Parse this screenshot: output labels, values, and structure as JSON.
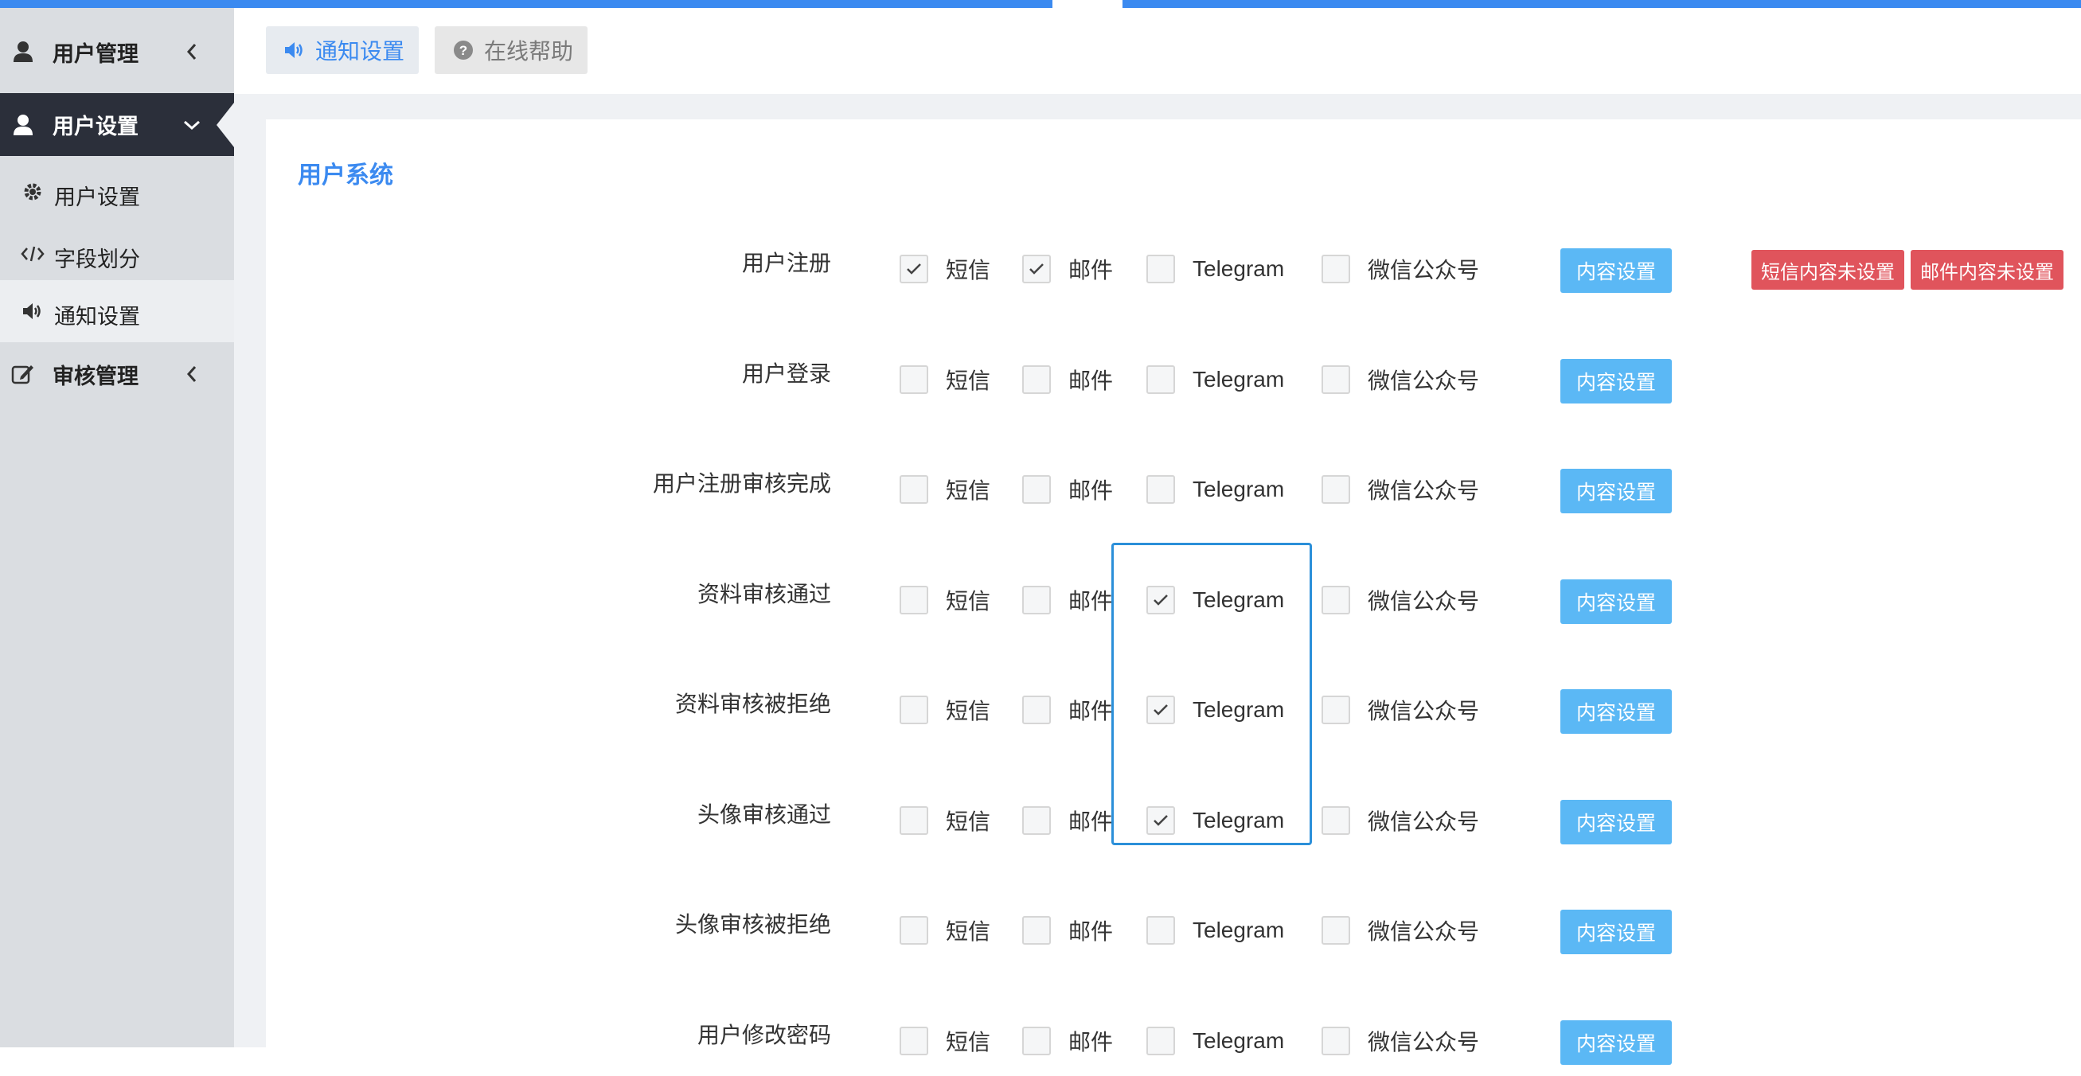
{
  "sidebar": {
    "items": [
      {
        "label": "用户管理"
      },
      {
        "label": "用户设置"
      },
      {
        "label": "审核管理"
      }
    ],
    "subitems": [
      {
        "label": "用户设置"
      },
      {
        "label": "字段划分"
      },
      {
        "label": "通知设置"
      }
    ]
  },
  "topbar": {
    "tab_notify": "通知设置",
    "tab_help": "在线帮助"
  },
  "panel": {
    "title": "用户系统"
  },
  "options": {
    "sms": "短信",
    "mail": "邮件",
    "telegram": "Telegram",
    "wechat": "微信公众号"
  },
  "buttons": {
    "content_settings": "内容设置",
    "sms_not_set": "短信内容未设置",
    "mail_not_set": "邮件内容未设置"
  },
  "rows": [
    {
      "label": "用户注册",
      "sms": true,
      "mail": true,
      "telegram": false,
      "wechat": false
    },
    {
      "label": "用户登录",
      "sms": false,
      "mail": false,
      "telegram": false,
      "wechat": false
    },
    {
      "label": "用户注册审核完成",
      "sms": false,
      "mail": false,
      "telegram": false,
      "wechat": false
    },
    {
      "label": "资料审核通过",
      "sms": false,
      "mail": false,
      "telegram": true,
      "wechat": false
    },
    {
      "label": "资料审核被拒绝",
      "sms": false,
      "mail": false,
      "telegram": true,
      "wechat": false
    },
    {
      "label": "头像审核通过",
      "sms": false,
      "mail": false,
      "telegram": true,
      "wechat": false
    },
    {
      "label": "头像审核被拒绝",
      "sms": false,
      "mail": false,
      "telegram": false,
      "wechat": false
    },
    {
      "label": "用户修改密码",
      "sms": false,
      "mail": false,
      "telegram": false,
      "wechat": false
    }
  ]
}
